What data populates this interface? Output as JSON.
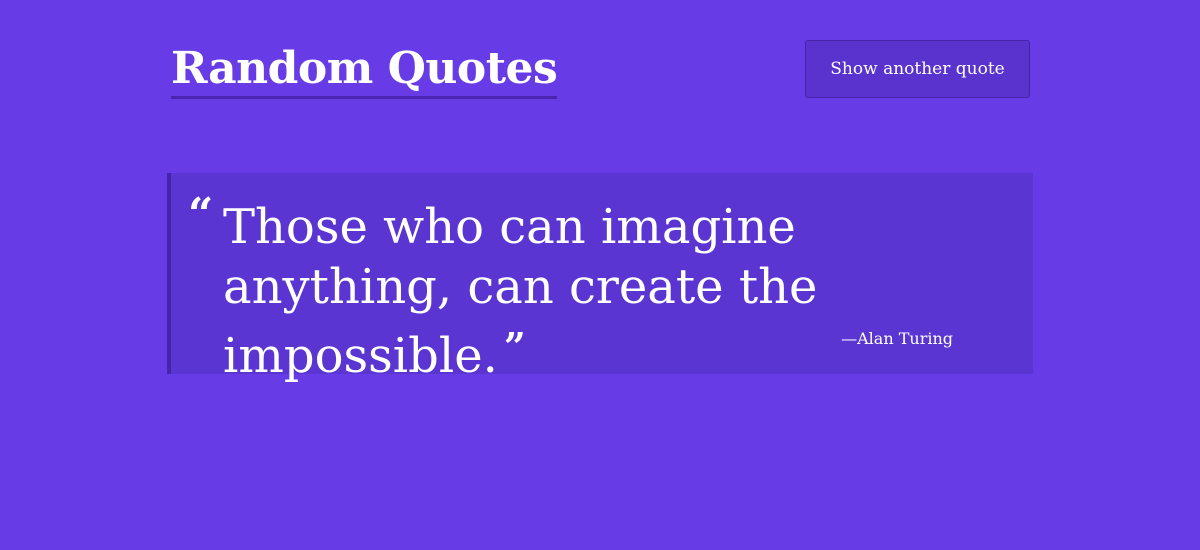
{
  "header": {
    "title": "Random Quotes",
    "button_label": "Show another quote"
  },
  "quote": {
    "open_mark": "“",
    "text": "Those who can imagine anything, can create the impossible.",
    "close_mark": "”",
    "author": "—Alan Turing"
  },
  "colors": {
    "background": "#673be6",
    "quote_box": "#5a35d1",
    "accent_border": "#4624aa",
    "text": "#ffffff"
  }
}
